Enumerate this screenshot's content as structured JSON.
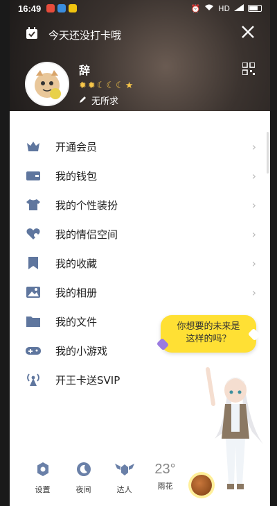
{
  "statusbar": {
    "time": "16:49",
    "network": "HD"
  },
  "header": {
    "checkin_text": "今天还没打卡哦",
    "user_name": "辞",
    "signature": "无所求",
    "level_icons": [
      "crown",
      "crown",
      "moon",
      "moon",
      "moon",
      "star"
    ]
  },
  "menu": [
    {
      "label": "开通会员",
      "icon": "vip-icon"
    },
    {
      "label": "我的钱包",
      "icon": "wallet-icon"
    },
    {
      "label": "我的个性装扮",
      "icon": "shirt-icon"
    },
    {
      "label": "我的情侣空间",
      "icon": "heart-icon"
    },
    {
      "label": "我的收藏",
      "icon": "bookmark-icon"
    },
    {
      "label": "我的相册",
      "icon": "image-icon"
    },
    {
      "label": "我的文件",
      "icon": "folder-icon"
    },
    {
      "label": "我的小游戏",
      "icon": "gamepad-icon"
    },
    {
      "label": "开王卡送SVIP",
      "icon": "antenna-icon"
    }
  ],
  "bubble": {
    "line1": "你想要的未来是",
    "line2": "这样的吗？"
  },
  "bottom": {
    "settings": "设置",
    "night": "夜间",
    "expert": "达人",
    "temperature": "23°",
    "weather": "雨花"
  },
  "colors": {
    "accent": "#6a80a8",
    "bubble": "#ffe034"
  }
}
